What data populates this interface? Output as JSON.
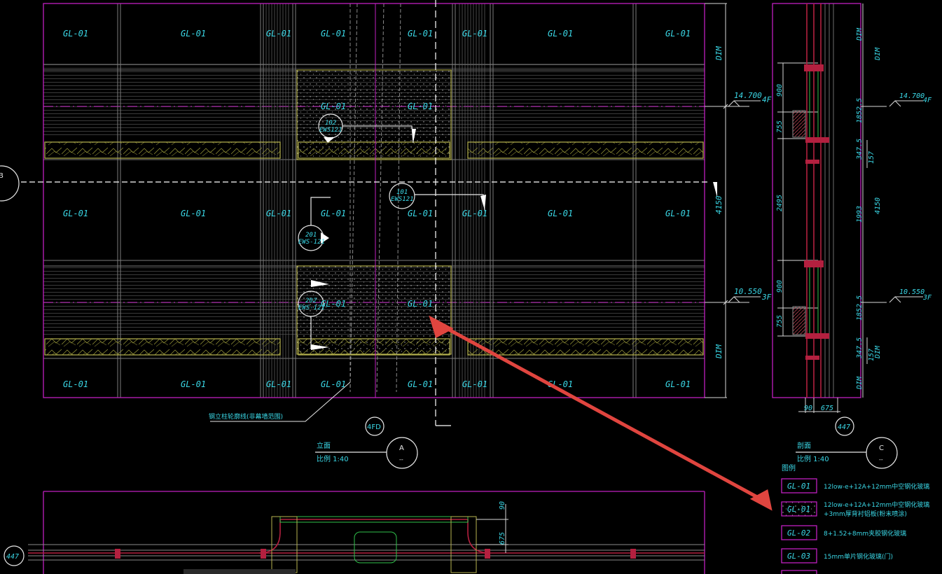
{
  "colors": {
    "background": "#000000",
    "frame": "#c020c0",
    "label": "#3ad7e6",
    "grid": "#8a8a8a",
    "dim": "#d8d8d8",
    "band": "#9c9b3a",
    "hatch": "#4c4c4c",
    "arrow": "#e0453f",
    "section_red": "#b3203f",
    "section_green": "#2fbf4a"
  },
  "elevation": {
    "row1": [
      "GL-01",
      "GL-01",
      "GL-01",
      "GL-01",
      "GL-01",
      "GL-01",
      "GL-01",
      "GL-01"
    ],
    "row2": [
      "GL-01",
      "GL-01"
    ],
    "row3": [
      "GL-01",
      "GL-01",
      "GL-01",
      "GL-01",
      "GL-01",
      "GL-01",
      "GL-01",
      "GL-01"
    ],
    "row4": [
      "GL-01",
      "GL-01"
    ],
    "row5": [
      "GL-01",
      "GL-01",
      "GL-01",
      "GL-01",
      "GL-01",
      "GL-01",
      "GL-01",
      "GL-01"
    ],
    "dim_top": "DIM",
    "dim_mid": "4150",
    "dim_bot": "DIM",
    "level_upper": "14.700",
    "level_upper_floor": "4F",
    "level_lower": "10.550",
    "level_lower_floor": "3F",
    "left_grid_bubble": "B",
    "bottom_bubble": "4FD",
    "leader_note": "钢立柱轮廓线(非幕墙范围)",
    "callouts": [
      {
        "num": "102",
        "ref": "EWS121"
      },
      {
        "num": "101",
        "ref": "EWS121"
      },
      {
        "num": "201",
        "ref": "EWS-121"
      },
      {
        "num": "202",
        "ref": "EWS-121"
      }
    ],
    "title": "立面",
    "scale": "比例  1:40",
    "title_bubble": "A",
    "title_bubble_sub": "--"
  },
  "section": {
    "dims_left": [
      "900",
      "755",
      "2495",
      "900",
      "755"
    ],
    "dims_right": [
      "DIM",
      "1852.5",
      "347.5",
      "157",
      "1993",
      "4150",
      "1852.5",
      "347.5",
      "157",
      "DIM",
      "DIM",
      "DIM"
    ],
    "bottom_dims": [
      "90",
      "675"
    ],
    "level_upper": "14.700",
    "level_upper_floor": "4F",
    "level_lower": "10.550",
    "level_lower_floor": "3F",
    "bottom_bubble": "447",
    "title": "剖面",
    "scale": "比例  1:40",
    "title_bubble": "C",
    "title_bubble_sub": "--"
  },
  "plan": {
    "left_bubble": "447",
    "dims": [
      "90",
      "675"
    ]
  },
  "legend": {
    "heading": "图例",
    "items": [
      {
        "code": "GL-01",
        "line1": "12low-e+12A+12mm中空钢化玻璃",
        "line2": ""
      },
      {
        "code": "GL-01",
        "line1": "12low-e+12A+12mm中空钢化玻璃",
        "line2": "+3mm厚背衬铝板(粉末喷涂)"
      },
      {
        "code": "GL-02",
        "line1": "8+1.52+8mm夹胶钢化玻璃",
        "line2": ""
      },
      {
        "code": "GL-03",
        "line1": "15mm单片钢化玻璃(门)",
        "line2": ""
      }
    ]
  }
}
